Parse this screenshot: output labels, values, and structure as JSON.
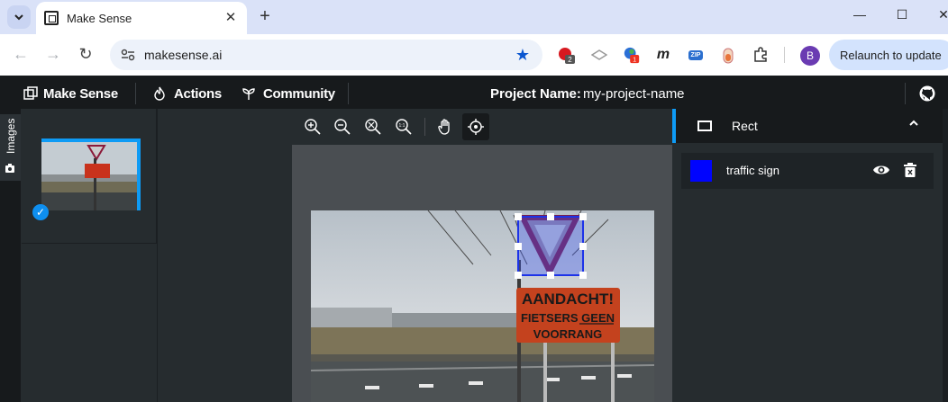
{
  "browser": {
    "tab_title": "Make Sense",
    "url": "makesense.ai",
    "relaunch_label": "Relaunch to update",
    "profile_initial": "B",
    "ext_badge_1": "2",
    "ext_badge_2": "1",
    "ext_m": "m",
    "ext_zip": "ZIP"
  },
  "app": {
    "brand": "Make Sense",
    "menu": [
      "Actions",
      "Community"
    ],
    "project_label": "Project Name:",
    "project_name": "my-project-name",
    "side_tab": "Images"
  },
  "labels_panel": {
    "tool": "Rect",
    "labels": [
      {
        "name": "traffic sign",
        "color": "#0004fe"
      }
    ]
  },
  "sign": {
    "line1": "AANDACHT!",
    "line2": "FIETSERS GEEN",
    "line3": "VOORRANG"
  }
}
